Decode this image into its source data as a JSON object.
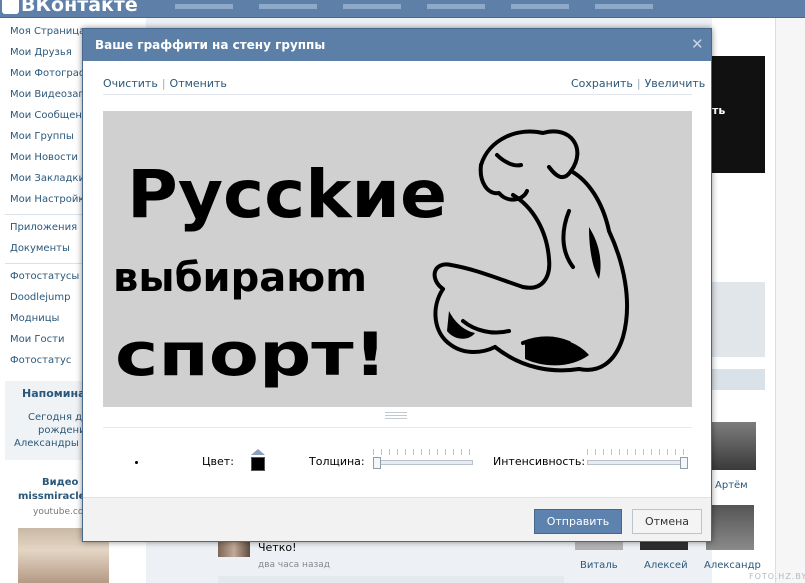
{
  "topbar": {
    "logo": "ВКонтакте"
  },
  "left_menu": {
    "items": [
      "Моя Страница",
      "Мои Друзья",
      "Мои Фотографии",
      "Мои Видеозаписи",
      "Мои Сообщения",
      "Мои Группы",
      "Мои Новости",
      "Мои Закладки",
      "Мои Настройки"
    ],
    "apps": [
      "Приложения",
      "Документы"
    ],
    "app_links": [
      "Фотостатусы",
      "Doodlejump",
      "Модницы",
      "Мои Гости",
      "Фотостатус"
    ],
    "reminder": {
      "title": "Напоминания",
      "lines": [
        "Сегодня день",
        "рождения",
        "Александры А."
      ]
    },
    "video": {
      "title_line1": "Видео",
      "title_line2": "missmiracle",
      "source": "youtube.com"
    }
  },
  "feed": {
    "post_text": "Четко!",
    "post_time": "два часа назад"
  },
  "friends": [
    "Артём",
    "Виталь",
    "Алексей",
    "Александр"
  ],
  "right_ad": {
    "text": "ть"
  },
  "watermark": "FOTO.HZ.BY",
  "modal": {
    "title": "Ваше граффити на стену группы",
    "close_icon": "close-icon",
    "tools": {
      "clear": "Очистить",
      "undo": "Отменить",
      "save": "Сохранить",
      "zoom": "Увеличить"
    },
    "canvas": {
      "background": "#d0d0d0",
      "lines": [
        "Руcckие",
        "выбираюm",
        "cпорт!"
      ]
    },
    "controls": {
      "color_label": "Цвет:",
      "color_value": "#000000",
      "thickness_label": "Толщина:",
      "thickness_value": 0.0,
      "intensity_label": "Интенсивность:",
      "intensity_value": 1.0
    },
    "buttons": {
      "send": "Отправить",
      "cancel": "Отмена"
    }
  },
  "colors": {
    "header": "#5b7fa6",
    "accent": "#5d82ad",
    "link": "#2b587a"
  }
}
